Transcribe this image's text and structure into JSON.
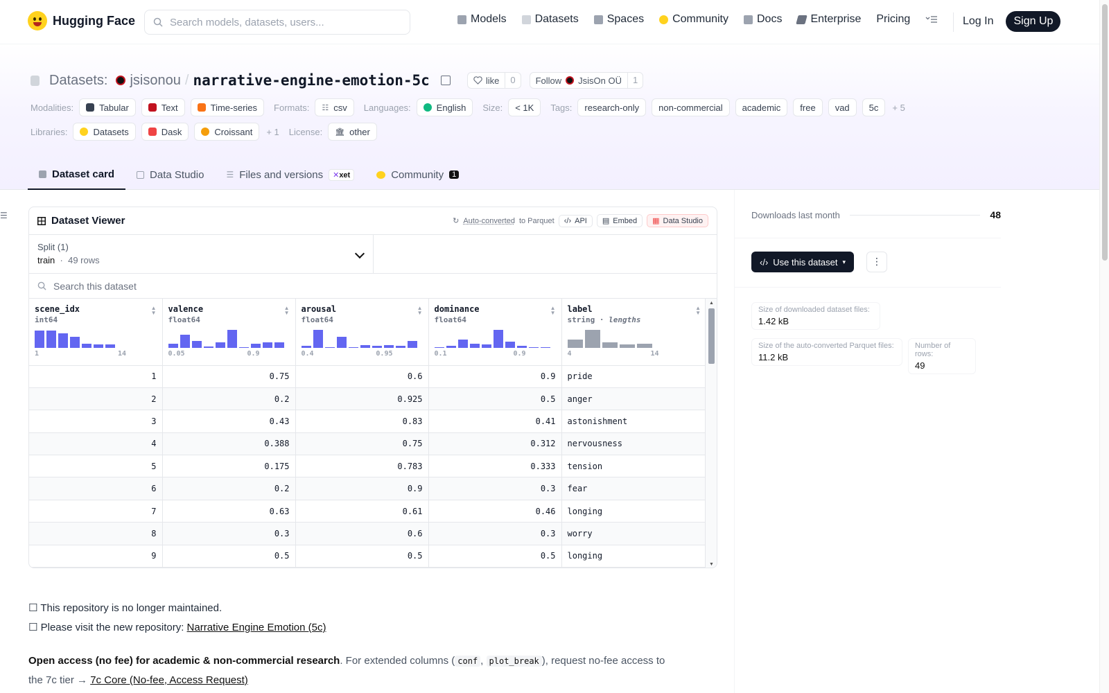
{
  "brand": {
    "name": "Hugging Face"
  },
  "nav": {
    "search_placeholder": "Search models, datasets, users...",
    "items": [
      {
        "label": "Models",
        "icon": "cube-icon",
        "color": "#9ca3af"
      },
      {
        "label": "Datasets",
        "icon": "database-icon",
        "color": "#d1d5db"
      },
      {
        "label": "Spaces",
        "icon": "spaces-icon",
        "color": "#9ca3af"
      },
      {
        "label": "Community",
        "icon": "community-icon",
        "color": "#FFD21E"
      },
      {
        "label": "Docs",
        "icon": "book-icon",
        "color": "#9ca3af"
      },
      {
        "label": "Enterprise",
        "icon": "enterprise-icon",
        "color": "#6b7280"
      },
      {
        "label": "Pricing",
        "icon": "",
        "color": ""
      }
    ],
    "login": "Log In",
    "signup": "Sign Up"
  },
  "repo": {
    "type_label": "Datasets:",
    "owner": "jsisonou",
    "separator": "/",
    "name": "narrative-engine-emotion-5c",
    "like_label": "like",
    "like_count": "0",
    "follow_label": "Follow",
    "follow_org": "JsisOn OÜ",
    "follow_count": "1"
  },
  "meta": {
    "modalities_key": "Modalities:",
    "modalities": [
      {
        "label": "Tabular",
        "color": "#374151"
      },
      {
        "label": "Text",
        "color": "#c1121f"
      },
      {
        "label": "Time-series",
        "color": "#f97316"
      }
    ],
    "formats_key": "Formats:",
    "formats": [
      "csv"
    ],
    "languages_key": "Languages:",
    "languages": [
      "English"
    ],
    "size_key": "Size:",
    "size": "< 1K",
    "tags_key": "Tags:",
    "tags": [
      "research-only",
      "non-commercial",
      "academic",
      "free",
      "vad",
      "5c"
    ],
    "tags_more": "+ 5",
    "libraries_key": "Libraries:",
    "libraries": [
      {
        "label": "Datasets",
        "color": "#FFD21E"
      },
      {
        "label": "Dask",
        "color": "#ef4444"
      },
      {
        "label": "Croissant",
        "color": "#f59e0b"
      }
    ],
    "libraries_more": "+ 1",
    "license_key": "License:",
    "license": "other"
  },
  "tabs": [
    {
      "label": "Dataset card",
      "active": true
    },
    {
      "label": "Data Studio",
      "active": false
    },
    {
      "label": "Files and versions",
      "active": false,
      "badge": "xet"
    },
    {
      "label": "Community",
      "active": false,
      "count": "1"
    }
  ],
  "viewer": {
    "title": "Dataset Viewer",
    "auto_converted": "Auto-converted",
    "to_parquet": "to Parquet",
    "api": "API",
    "embed": "Embed",
    "data_studio": "Data Studio",
    "split_label": "Split (1)",
    "split_name": "train",
    "split_rows": "49 rows",
    "search_placeholder": "Search this dataset",
    "columns": [
      {
        "name": "scene_idx",
        "type": "int64",
        "min": "1",
        "max": "14",
        "hist": [
          0.95,
          0.95,
          0.8,
          0.6,
          0.25,
          0.18,
          0.18
        ]
      },
      {
        "name": "valence",
        "type": "float64",
        "min": "0.05",
        "max": "0.9",
        "hist": [
          0.25,
          0.75,
          0.4,
          0.08,
          0.3,
          1.0,
          0.05,
          0.25,
          0.3,
          0.3
        ]
      },
      {
        "name": "arousal",
        "type": "float64",
        "min": "0.4",
        "max": "0.95",
        "hist": [
          0.12,
          1.0,
          0.0,
          0.62,
          0.0,
          0.15,
          0.1,
          0.15,
          0.1,
          0.38
        ]
      },
      {
        "name": "dominance",
        "type": "float64",
        "min": "0.1",
        "max": "0.9",
        "hist": [
          0.05,
          0.12,
          0.45,
          0.25,
          0.18,
          1.0,
          0.35,
          0.12,
          0.05,
          0.05
        ]
      },
      {
        "name": "label",
        "type": "string",
        "type_extra": "lengths",
        "min": "4",
        "max": "14",
        "hist": [
          0.45,
          1.0,
          0.3,
          0.18,
          0.22
        ]
      }
    ],
    "rows": [
      [
        "1",
        "0.75",
        "0.6",
        "0.9",
        "pride"
      ],
      [
        "2",
        "0.2",
        "0.925",
        "0.5",
        "anger"
      ],
      [
        "3",
        "0.43",
        "0.83",
        "0.41",
        "astonishment"
      ],
      [
        "4",
        "0.388",
        "0.75",
        "0.312",
        "nervousness"
      ],
      [
        "5",
        "0.175",
        "0.783",
        "0.333",
        "tension"
      ],
      [
        "6",
        "0.2",
        "0.9",
        "0.3",
        "fear"
      ],
      [
        "7",
        "0.63",
        "0.61",
        "0.46",
        "longing"
      ],
      [
        "8",
        "0.3",
        "0.6",
        "0.3",
        "worry"
      ],
      [
        "9",
        "0.5",
        "0.5",
        "0.5",
        "longing"
      ]
    ]
  },
  "notes": {
    "line1": "☐ This repository is no longer maintained.",
    "line2_prefix": "☐ Please visit the new repository: ",
    "line2_link": "Narrative Engine Emotion (5c)"
  },
  "para": {
    "bold": "Open access (no fee) for academic & non-commercial research",
    "text1": ". For extended columns (",
    "code1": "conf",
    "comma": ", ",
    "code2": "plot_break",
    "text2": "), request no-fee access to the 7c tier → ",
    "link": "7c Core (No-fee, Access Request)"
  },
  "sidebar": {
    "downloads_label": "Downloads last month",
    "downloads_value": "48",
    "use_button": "Use this dataset",
    "stats": [
      {
        "key": "Size of downloaded dataset files:",
        "value": "1.42 kB"
      },
      {
        "key": "Size of the auto-converted Parquet files:",
        "value": "11.2 kB"
      },
      {
        "key": "Number of rows:",
        "value": "49"
      }
    ]
  }
}
